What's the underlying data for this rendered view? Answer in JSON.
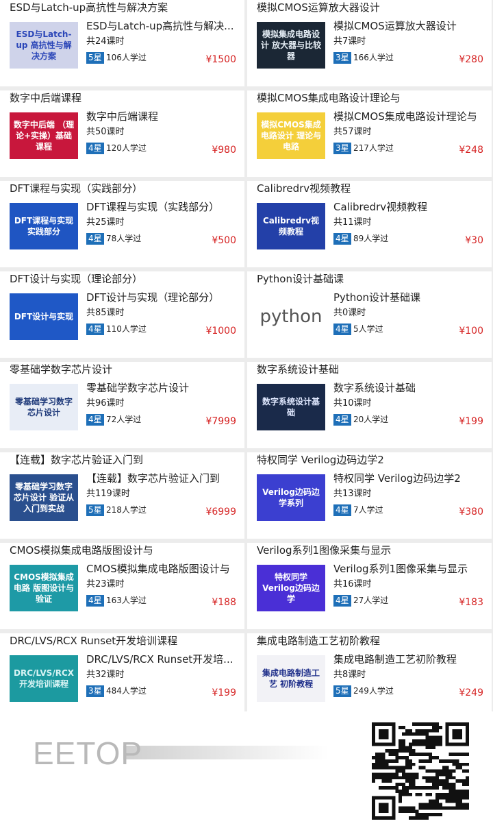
{
  "colors": {
    "price": "#d62424",
    "star_badge": "#1e6fb8"
  },
  "courses": [
    {
      "title": "ESD与Latch-up高抗性与解决方案",
      "card_title": "ESD与Latch-up高抗性与解决...",
      "hours": "共24课时",
      "stars": "5星",
      "learners": "106人学过",
      "price": "¥1500",
      "thumb_text": "ESD与Latch-up 高抗性与解决方案",
      "thumb_bg": "#cfd3ea",
      "thumb_fg": "#2b46b8"
    },
    {
      "title": "模拟CMOS运算放大器设计",
      "card_title": "模拟CMOS运算放大器设计",
      "hours": "共7课时",
      "stars": "3星",
      "learners": "166人学过",
      "price": "¥280",
      "thumb_text": "模拟集成电路设计 放大器与比较器",
      "thumb_bg": "#1b2735",
      "thumb_fg": "#e6eef6"
    },
    {
      "title": "数字中后端课程",
      "card_title": "数字中后端课程",
      "hours": "共50课时",
      "stars": "4星",
      "learners": "120人学过",
      "price": "¥980",
      "thumb_text": "数字中后端 （理论+实操）基础课程",
      "thumb_bg": "#c8173c",
      "thumb_fg": "#ffffff"
    },
    {
      "title": "模拟CMOS集成电路设计理论与",
      "card_title": "模拟CMOS集成电路设计理论与",
      "hours": "共57课时",
      "stars": "3星",
      "learners": "217人学过",
      "price": "¥248",
      "thumb_text": "模拟CMOS集成电路设计 理论与电路",
      "thumb_bg": "#f4cf3a",
      "thumb_fg": "#ffffff"
    },
    {
      "title": "DFT课程与实现（实践部分）",
      "card_title": "DFT课程与实现（实践部分）",
      "hours": "共25课时",
      "stars": "4星",
      "learners": "78人学过",
      "price": "¥500",
      "thumb_text": "DFT课程与实现 实践部分",
      "thumb_bg": "#1f55c2",
      "thumb_fg": "#ffffff"
    },
    {
      "title": "Calibredrv视频教程",
      "card_title": "Calibredrv视频教程",
      "hours": "共11课时",
      "stars": "4星",
      "learners": "89人学过",
      "price": "¥30",
      "thumb_text": "Calibredrv视频教程",
      "thumb_bg": "#2340a8",
      "thumb_fg": "#ffffff"
    },
    {
      "title": "DFT设计与实现（理论部分）",
      "card_title": "DFT设计与实现（理论部分）",
      "hours": "共85课时",
      "stars": "4星",
      "learners": "110人学过",
      "price": "¥1000",
      "thumb_text": "DFT设计与实现",
      "thumb_bg": "#1f58c6",
      "thumb_fg": "#ffffff"
    },
    {
      "title": "Python设计基础课",
      "card_title": "Python设计基础课",
      "hours": "共0课时",
      "stars": "4星",
      "learners": "5人学过",
      "price": "¥100",
      "thumb_text": "python",
      "thumb_bg": "#ffffff",
      "thumb_fg": "#555555"
    },
    {
      "title": "零基础学数字芯片设计",
      "card_title": "零基础学数字芯片设计",
      "hours": "共96课时",
      "stars": "4星",
      "learners": "72人学过",
      "price": "¥7999",
      "thumb_text": "零基础学习数字芯片设计",
      "thumb_bg": "#e8edf6",
      "thumb_fg": "#1f3a7a"
    },
    {
      "title": "数字系统设计基础",
      "card_title": "数字系统设计基础",
      "hours": "共10课时",
      "stars": "4星",
      "learners": "20人学过",
      "price": "¥199",
      "thumb_text": "数字系统设计基础",
      "thumb_bg": "#1a2a4a",
      "thumb_fg": "#e0e8ff"
    },
    {
      "title": "【连载】数字芯片验证入门到",
      "card_title": "【连载】数字芯片验证入门到",
      "hours": "共119课时",
      "stars": "5星",
      "learners": "218人学过",
      "price": "¥6999",
      "thumb_text": "零基础学习数字芯片设计 验证从入门到实战",
      "thumb_bg": "#2a4f8e",
      "thumb_fg": "#ffffff"
    },
    {
      "title": "特权同学 Verilog边码边学2",
      "card_title": "特权同学 Verilog边码边学2",
      "hours": "共13课时",
      "stars": "4星",
      "learners": "7人学过",
      "price": "¥380",
      "thumb_text": "Verilog边码边学系列",
      "thumb_bg": "#3b3fd0",
      "thumb_fg": "#ffffff"
    },
    {
      "title": "CMOS模拟集成电路版图设计与",
      "card_title": "CMOS模拟集成电路版图设计与",
      "hours": "共23课时",
      "stars": "4星",
      "learners": "163人学过",
      "price": "¥188",
      "thumb_text": "CMOS模拟集成电路 版图设计与验证",
      "thumb_bg": "#1e9aa6",
      "thumb_fg": "#ffffff"
    },
    {
      "title": "Verilog系列1图像采集与显示",
      "card_title": "Verilog系列1图像采集与显示",
      "hours": "共16课时",
      "stars": "4星",
      "learners": "27人学过",
      "price": "¥183",
      "thumb_text": "特权同学 Verilog边码边学",
      "thumb_bg": "#4a2fd6",
      "thumb_fg": "#ffffff"
    },
    {
      "title": "DRC/LVS/RCX Runset开发培训课程",
      "card_title": "DRC/LVS/RCX Runset开发培...",
      "hours": "共32课时",
      "stars": "3星",
      "learners": "484人学过",
      "price": "¥199",
      "thumb_text": "DRC/LVS/RCX开发培训课程",
      "thumb_bg": "#1c9aa0",
      "thumb_fg": "#d8f4f4"
    },
    {
      "title": "集成电路制造工艺初阶教程",
      "card_title": "集成电路制造工艺初阶教程",
      "hours": "共8课时",
      "stars": "5星",
      "learners": "249人学过",
      "price": "¥249",
      "thumb_text": "集成电路制造工艺 初阶教程",
      "thumb_bg": "#f2f2f6",
      "thumb_fg": "#1f2f8a"
    }
  ],
  "footer": {
    "logo_text": "EETOP",
    "qr_icon": "qr-code-icon"
  }
}
